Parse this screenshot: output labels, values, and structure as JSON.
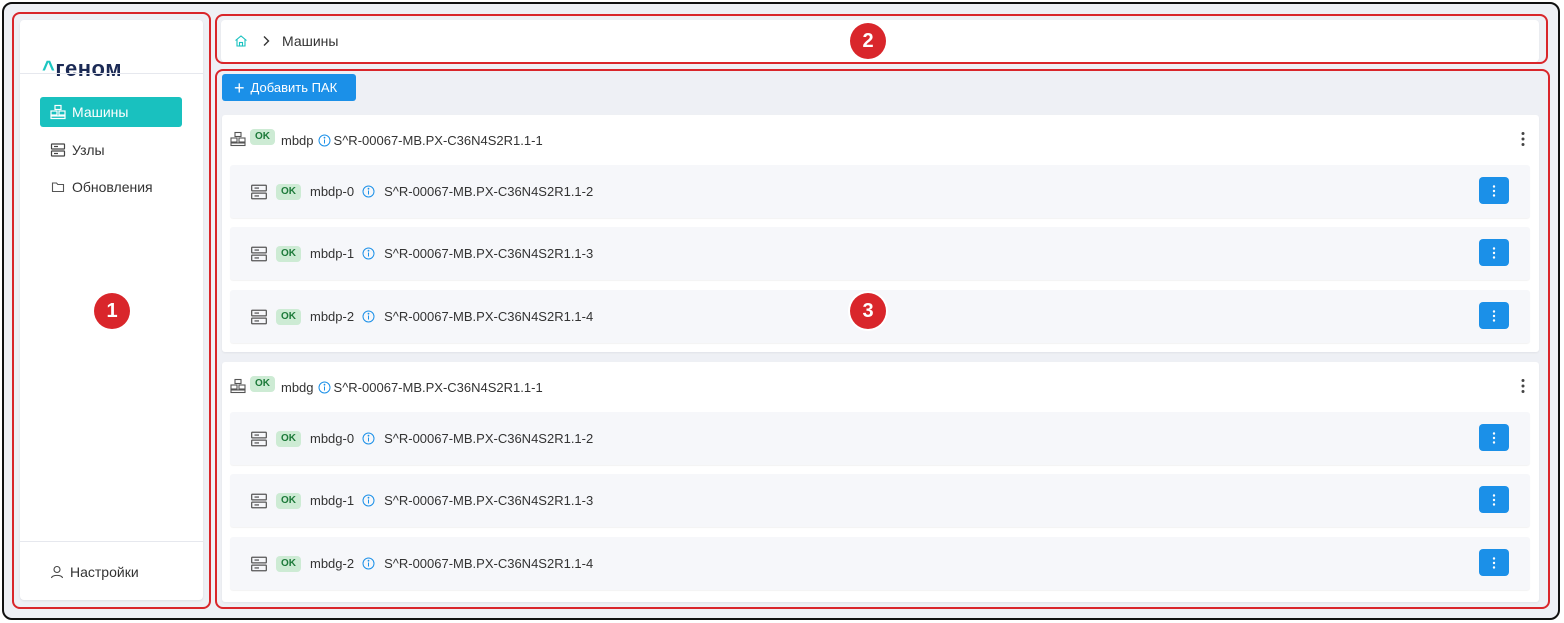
{
  "brand": {
    "caret": "^",
    "name": "геном"
  },
  "sidebar": {
    "items": [
      {
        "label": "Машины",
        "icon": "machines-icon",
        "active": true
      },
      {
        "label": "Узлы",
        "icon": "server-icon",
        "active": false
      },
      {
        "label": "Обновления",
        "icon": "folder-icon",
        "active": false
      }
    ],
    "settings_label": "Настройки"
  },
  "breadcrumb": {
    "current": "Машины"
  },
  "toolbar": {
    "add_label": "Добавить ПАК"
  },
  "groups": [
    {
      "status": "OK",
      "name": "mbdp",
      "serial": "S^R-00067-MB.PX-C36N4S2R1.1-1",
      "rows": [
        {
          "status": "OK",
          "name": "mbdp-0",
          "serial": "S^R-00067-MB.PX-C36N4S2R1.1-2"
        },
        {
          "status": "OK",
          "name": "mbdp-1",
          "serial": "S^R-00067-MB.PX-C36N4S2R1.1-3"
        },
        {
          "status": "OK",
          "name": "mbdp-2",
          "serial": "S^R-00067-MB.PX-C36N4S2R1.1-4"
        }
      ]
    },
    {
      "status": "OK",
      "name": "mbdg",
      "serial": "S^R-00067-MB.PX-C36N4S2R1.1-1",
      "rows": [
        {
          "status": "OK",
          "name": "mbdg-0",
          "serial": "S^R-00067-MB.PX-C36N4S2R1.1-2"
        },
        {
          "status": "OK",
          "name": "mbdg-1",
          "serial": "S^R-00067-MB.PX-C36N4S2R1.1-3"
        },
        {
          "status": "OK",
          "name": "mbdg-2",
          "serial": "S^R-00067-MB.PX-C36N4S2R1.1-4"
        }
      ]
    }
  ],
  "annotations": [
    "1",
    "2",
    "3"
  ],
  "colors": {
    "accent": "#19c1bf",
    "primary": "#1b90e8",
    "annotation": "#d9262b",
    "ok_bg": "#cdebd4",
    "ok_text": "#1d7a3a"
  }
}
